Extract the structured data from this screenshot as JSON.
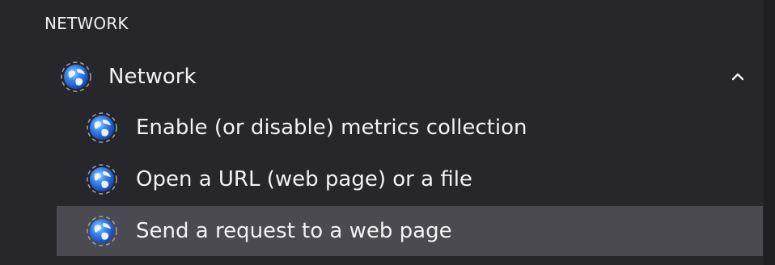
{
  "section": {
    "heading": "NETWORK"
  },
  "group": {
    "label": "Network",
    "icon": "globe-icon",
    "expanded": true,
    "toggle_icon": "chevron-up-icon"
  },
  "items": [
    {
      "label": "Enable (or disable) metrics collection",
      "icon": "globe-icon",
      "selected": false
    },
    {
      "label": "Open a URL (web page) or a file",
      "icon": "globe-icon",
      "selected": false
    },
    {
      "label": "Send a request to a web page",
      "icon": "globe-icon",
      "selected": true
    }
  ],
  "colors": {
    "background": "#26262b",
    "selected_row": "#4a4a50",
    "text": "#f2f2f4",
    "globe_blue": "#2f6fe0"
  }
}
